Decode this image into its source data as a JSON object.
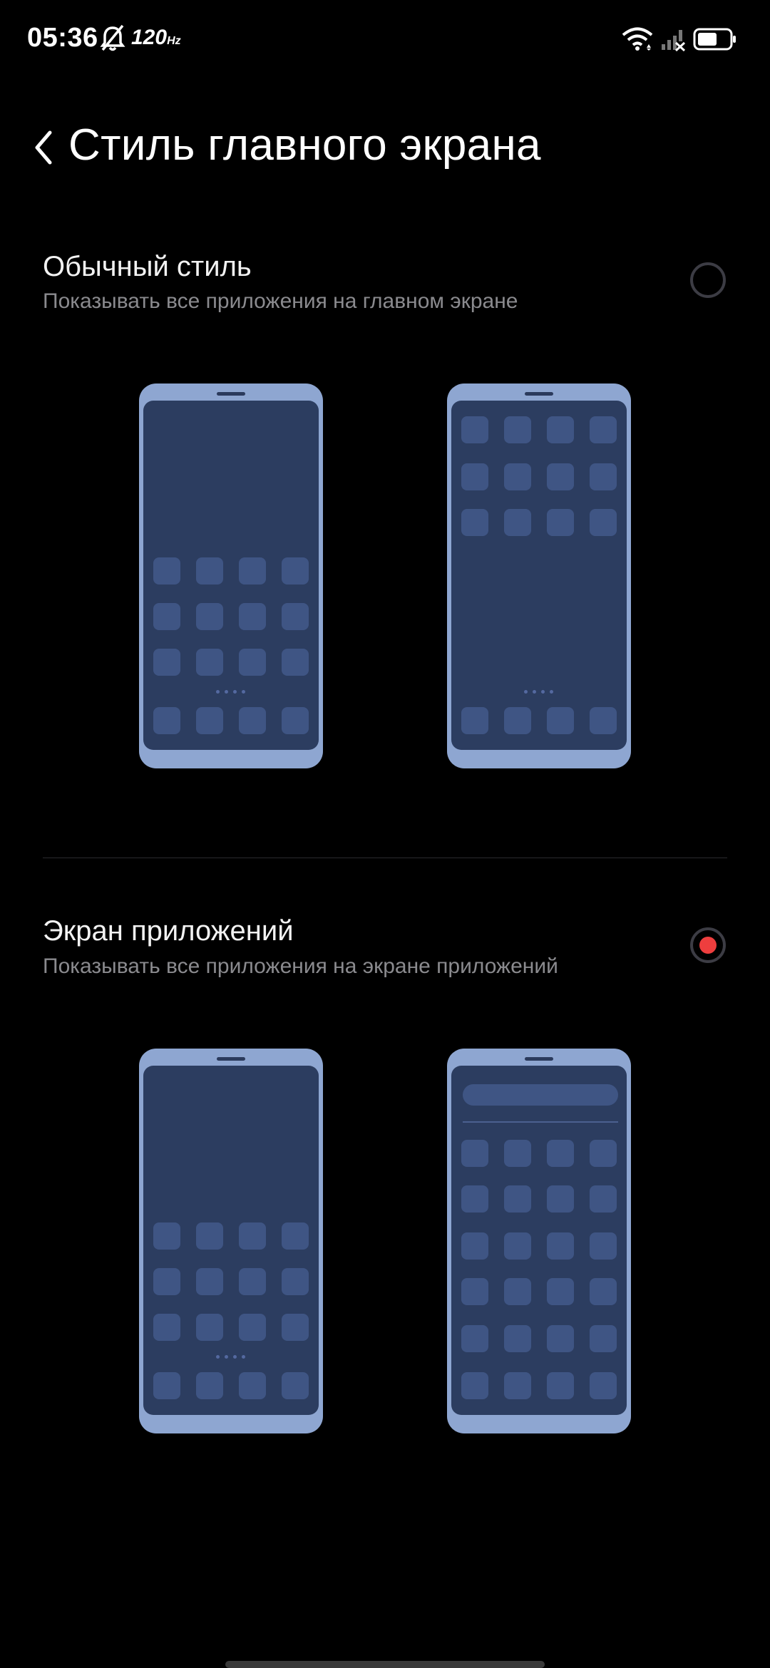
{
  "status_bar": {
    "time": "05:36",
    "refresh_rate": "120",
    "refresh_unit": "Hz",
    "icons": [
      "bell-off-icon",
      "wifi-icon",
      "signal-x-icon",
      "battery-icon"
    ]
  },
  "header": {
    "title": "Стиль главного экрана",
    "back_icon": "chevron-left-icon"
  },
  "options": [
    {
      "title": "Обычный стиль",
      "subtitle": "Показывать все приложения на главном экране",
      "selected": false
    },
    {
      "title": "Экран приложений",
      "subtitle": "Показывать все приложения на экране приложений",
      "selected": true
    }
  ],
  "colors": {
    "background": "#000000",
    "radio_selected": "#ee3e3e",
    "phone_frame": "#8ea6d1",
    "phone_screen": "#2c3d60",
    "app_tile": "#3f5584"
  }
}
